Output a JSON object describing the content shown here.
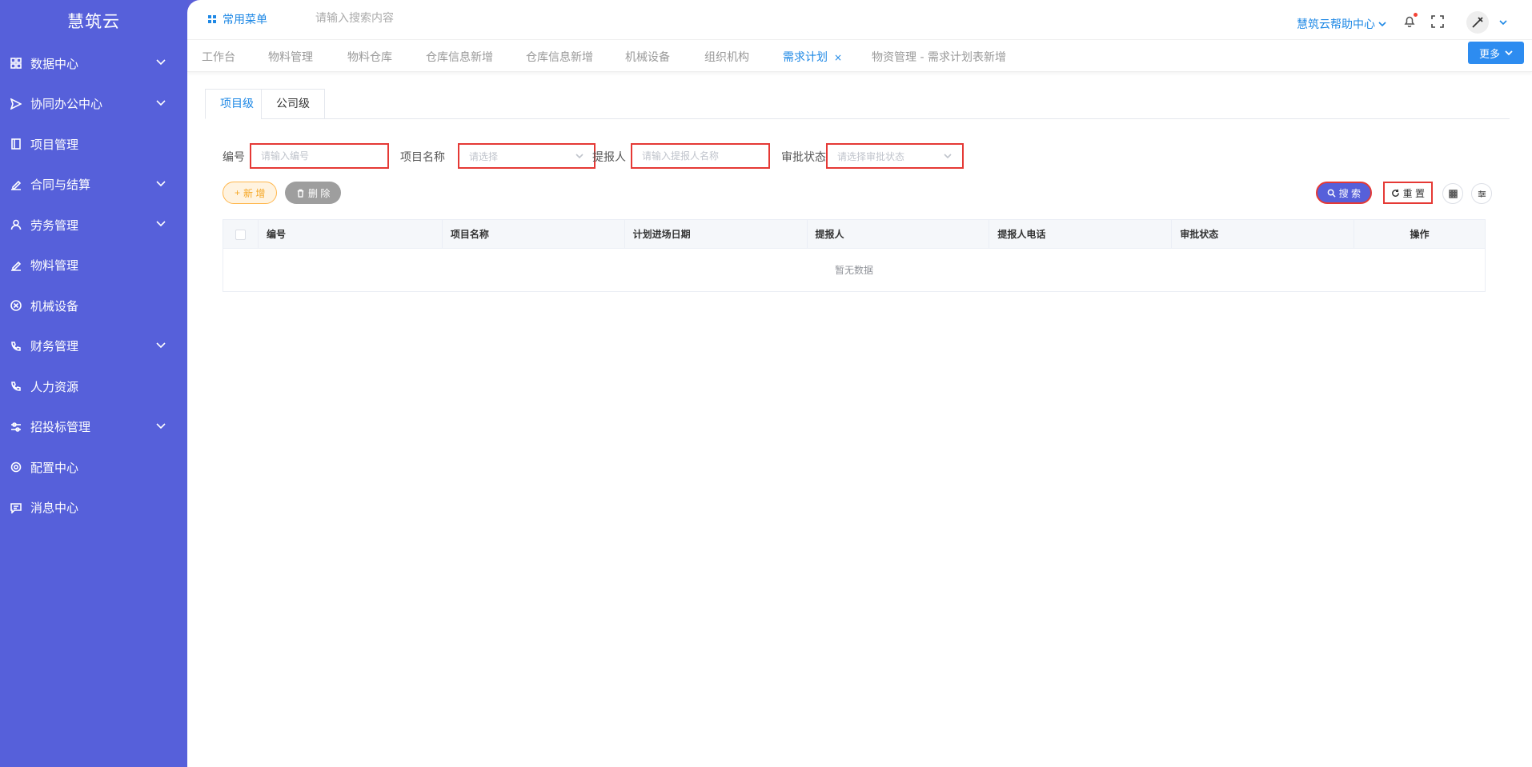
{
  "sidebar": {
    "brand": "慧筑云",
    "items": [
      {
        "label": "数据中心",
        "icon": "grid-icon",
        "expandable": true
      },
      {
        "label": "协同办公中心",
        "icon": "send-icon",
        "expandable": true
      },
      {
        "label": "项目管理",
        "icon": "book-icon",
        "expandable": false
      },
      {
        "label": "合同与结算",
        "icon": "edit-icon",
        "expandable": true
      },
      {
        "label": "劳务管理",
        "icon": "user-icon",
        "expandable": true
      },
      {
        "label": "物料管理",
        "icon": "edit-icon",
        "expandable": false
      },
      {
        "label": "机械设备",
        "icon": "close-circle-icon",
        "expandable": false
      },
      {
        "label": "财务管理",
        "icon": "phone-icon",
        "expandable": true
      },
      {
        "label": "人力资源",
        "icon": "phone-icon",
        "expandable": false
      },
      {
        "label": "招投标管理",
        "icon": "sliders-icon",
        "expandable": true
      },
      {
        "label": "配置中心",
        "icon": "gear-icon",
        "expandable": false
      },
      {
        "label": "消息中心",
        "icon": "message-icon",
        "expandable": false
      }
    ]
  },
  "topbar": {
    "common_menu": "常用菜单",
    "search_placeholder": "请输入搜索内容",
    "help_center": "慧筑云帮助中心"
  },
  "tabs": {
    "items": [
      {
        "label": "工作台",
        "active": false
      },
      {
        "label": "物料管理",
        "active": false
      },
      {
        "label": "物料仓库",
        "active": false
      },
      {
        "label": "仓库信息新增",
        "active": false
      },
      {
        "label": "仓库信息新增",
        "active": false
      },
      {
        "label": "机械设备",
        "active": false
      },
      {
        "label": "组织机构",
        "active": false
      },
      {
        "label": "需求计划",
        "active": true,
        "close": "×"
      },
      {
        "label": "物资管理 - 需求计划表新增",
        "active": false
      }
    ],
    "more_label": "更多"
  },
  "sub_tabs": [
    {
      "label": "项目级",
      "active": true
    },
    {
      "label": "公司级",
      "active": false
    }
  ],
  "filters": {
    "code_label": "编号",
    "code_placeholder": "请输入编号",
    "project_label": "项目名称",
    "project_placeholder": "请选择",
    "reporter_label": "提报人",
    "reporter_placeholder": "请输入提报人名称",
    "status_label": "审批状态",
    "status_placeholder": "请选择审批状态"
  },
  "actions": {
    "add_label": "新 增",
    "delete_label": "删 除",
    "search_label": "搜 索",
    "reset_label": "重 置"
  },
  "table": {
    "columns": [
      "编号",
      "项目名称",
      "计划进场日期",
      "提报人",
      "提报人电话",
      "审批状态",
      "操作"
    ],
    "empty_text": "暂无数据"
  },
  "colors": {
    "sidebar_bg": "#5660da",
    "primary": "#1e88e5",
    "highlight_border": "#e53935"
  }
}
